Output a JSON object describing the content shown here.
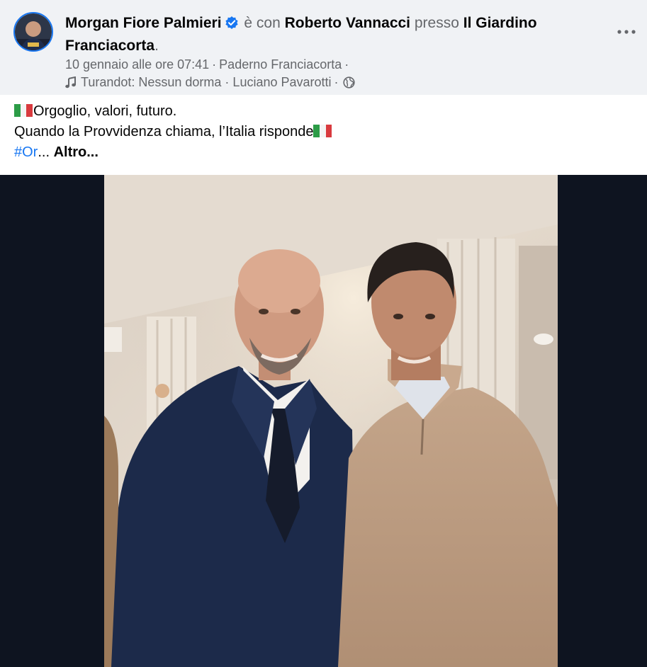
{
  "header": {
    "author": "Morgan Fiore Palmieri",
    "with_text": "è con",
    "tagged_person": "Roberto Vannacci",
    "at_text": "presso",
    "place": "Il Giardino Franciacorta",
    "period": ".",
    "date": "10 gennaio alle ore 07:41",
    "location": "Paderno Franciacorta",
    "music": "Turandot: Nessun dorma · Luciano Pavarotti",
    "separator": "·"
  },
  "post": {
    "line1": "Orgoglio, valori, futuro.",
    "line2": "Quando la Provvidenza chiama, l’Italia risponde",
    "hashtag": "#Or",
    "ellipsis": "...",
    "more": "Altro..."
  },
  "colors": {
    "accent": "#1877f2",
    "header_bg": "#f0f2f5",
    "secondary_text": "#65676b",
    "photo_frame": "#0e1420",
    "flag_green": "#2c9c47",
    "flag_white": "#f4f4f4",
    "flag_red": "#d93a3e"
  },
  "icons": [
    "verified-badge-icon",
    "more-options-icon",
    "music-note-icon",
    "globe-icon",
    "italian-flag-icon"
  ]
}
